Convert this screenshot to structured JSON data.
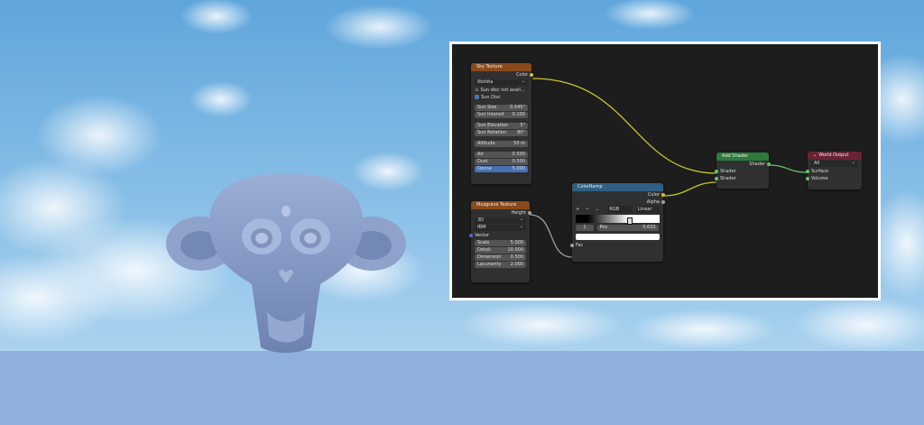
{
  "nodes": {
    "sky": {
      "title": "Sky Texture",
      "out_color": "Color",
      "sky_type": "Nishita",
      "warning": "Sun disc not avail...",
      "sun_disc": "Sun Disc",
      "sun_size_label": "Sun Size",
      "sun_size": "0.545°",
      "sun_intensity_label": "Sun Intensit",
      "sun_intensity": "0.100",
      "sun_elevation_label": "Sun Elevation",
      "sun_elevation": "5°",
      "sun_rotation_label": "Sun Rotation",
      "sun_rotation": "80°",
      "altitude_label": "Altitude",
      "altitude": "50 m",
      "air_label": "Air",
      "air": "0.500",
      "dust_label": "Dust",
      "dust": "0.500",
      "ozone_label": "Ozone",
      "ozone": "5.000",
      "air_level": 0.5,
      "dust_level": 0.5,
      "ozone_level": 0.5
    },
    "musgrave": {
      "title": "Musgrave Texture",
      "out_height": "Height",
      "dimensions": "3D",
      "type": "fBM",
      "vector": "Vector",
      "scale_label": "Scale",
      "scale": "5.000",
      "detail_label": "Detail",
      "detail": "10.000",
      "dimension_label": "Dimension",
      "dimension": "0.500",
      "lacunarity_label": "Lacunarity",
      "lacunarity": "2.000"
    },
    "colorramp": {
      "title": "ColorRamp",
      "out_color": "Color",
      "out_alpha": "Alpha",
      "plus": "+",
      "minus": "−",
      "mode": "RGB",
      "interp": "Linear",
      "index": "1",
      "pos_label": "Pos",
      "pos": "0.633",
      "fac": "Fac",
      "stop_position": 0.633
    },
    "add": {
      "title": "Add Shader",
      "out_shader": "Shader",
      "in_shader1": "Shader",
      "in_shader2": "Shader"
    },
    "world": {
      "title": "World Output",
      "target": "All",
      "surface": "Surface",
      "volume": "Volume"
    }
  },
  "colors": {
    "texture_header": "#8a4a1e",
    "converter_header": "#2f5f82",
    "shader_header": "#2d7a3a",
    "output_header": "#6b2233",
    "socket_color": "#c7c729",
    "socket_shader": "#63c763",
    "socket_float": "#a1a1a1",
    "socket_vector": "#6363c7"
  }
}
